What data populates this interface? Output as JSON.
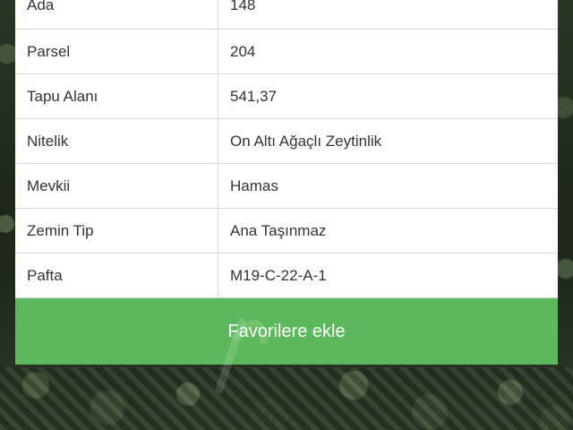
{
  "parcel_info": {
    "rows": [
      {
        "label": "Ada",
        "value": "148"
      },
      {
        "label": "Parsel",
        "value": "204"
      },
      {
        "label": "Tapu Alanı",
        "value": "541,37"
      },
      {
        "label": "Nitelik",
        "value": "On Altı Ağaçlı Zeytinlik"
      },
      {
        "label": "Mevkii",
        "value": "Hamas"
      },
      {
        "label": "Zemin Tip",
        "value": "Ana Taşınmaz"
      },
      {
        "label": "Pafta",
        "value": "M19-C-22-A-1"
      }
    ]
  },
  "actions": {
    "favorite_label": "Favorilere ekle"
  },
  "colors": {
    "button_green": "#5cb85c",
    "panel_bg": "#ffffff",
    "divider": "#d9d9d9",
    "text": "#333333"
  }
}
